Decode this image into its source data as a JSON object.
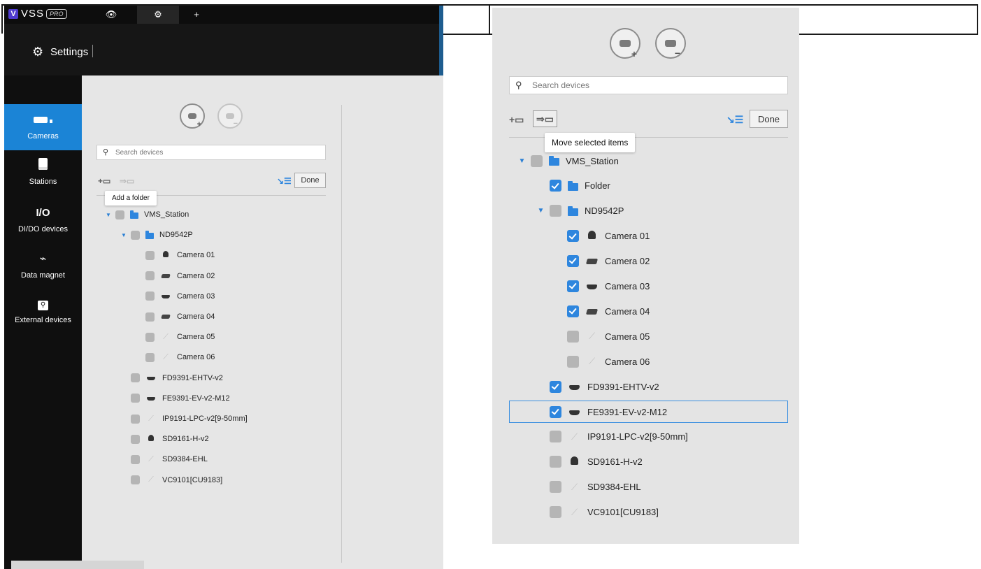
{
  "left_panel": {
    "app": {
      "logo_letter": "V",
      "name": "VSS",
      "badge": "PRO"
    },
    "top_tabs": [
      {
        "icon": "eye-icon",
        "glyph": "👁"
      },
      {
        "icon": "gear-icon",
        "glyph": "⚙"
      },
      {
        "icon": "plus-icon",
        "glyph": "+"
      }
    ],
    "header": {
      "title": "Settings"
    },
    "nav": [
      {
        "label": "Cameras",
        "icon": "camera-icon",
        "active": true
      },
      {
        "label": "Stations",
        "icon": "station-icon",
        "active": false
      },
      {
        "label": "DI/DO devices",
        "icon": "io-icon",
        "glyph": "I/O",
        "active": false
      },
      {
        "label": "Data magnet",
        "icon": "data-magnet-icon",
        "active": false
      },
      {
        "label": "External devices",
        "icon": "external-device-icon",
        "active": false
      }
    ],
    "search": {
      "placeholder": "Search devices"
    },
    "toolbar": {
      "done_label": "Done",
      "tooltip": "Add a folder"
    },
    "tree": [
      {
        "label": "VMS_Station",
        "type": "folder",
        "expanded": true
      },
      {
        "label": "ND9542P",
        "type": "folder",
        "expanded": true
      },
      {
        "label": "Camera 01",
        "type": "dome"
      },
      {
        "label": "Camera 02",
        "type": "bullet"
      },
      {
        "label": "Camera 03",
        "type": "flat"
      },
      {
        "label": "Camera 04",
        "type": "bullet"
      },
      {
        "label": "Camera 05",
        "type": "offline"
      },
      {
        "label": "Camera 06",
        "type": "offline"
      },
      {
        "label": "FD9391-EHTV-v2",
        "type": "flat"
      },
      {
        "label": "FE9391-EV-v2-M12",
        "type": "fisheye"
      },
      {
        "label": "IP9191-LPC-v2[9-50mm]",
        "type": "offline"
      },
      {
        "label": "SD9161-H-v2",
        "type": "dome"
      },
      {
        "label": "SD9384-EHL",
        "type": "offline"
      },
      {
        "label": "VC9101[CU9183]",
        "type": "offline"
      }
    ]
  },
  "right_panel": {
    "search": {
      "placeholder": "Search devices"
    },
    "toolbar": {
      "done_label": "Done",
      "tooltip": "Move selected items"
    },
    "tree": [
      {
        "label": "VMS_Station",
        "type": "folder",
        "expanded": true,
        "checked": false
      },
      {
        "label": "Folder",
        "type": "folder",
        "checked": true
      },
      {
        "label": "ND9542P",
        "type": "folder",
        "expanded": true,
        "checked": false
      },
      {
        "label": "Camera 01",
        "type": "dome",
        "checked": true
      },
      {
        "label": "Camera 02",
        "type": "bullet",
        "checked": true
      },
      {
        "label": "Camera 03",
        "type": "flat",
        "checked": true
      },
      {
        "label": "Camera 04",
        "type": "bullet",
        "checked": true
      },
      {
        "label": "Camera 05",
        "type": "offline",
        "checked": false
      },
      {
        "label": "Camera 06",
        "type": "offline",
        "checked": false
      },
      {
        "label": "FD9391-EHTV-v2",
        "type": "flat",
        "checked": true
      },
      {
        "label": "FE9391-EV-v2-M12",
        "type": "fisheye",
        "checked": true,
        "focused": true
      },
      {
        "label": "IP9191-LPC-v2[9-50mm]",
        "type": "offline",
        "checked": false
      },
      {
        "label": "SD9161-H-v2",
        "type": "dome",
        "checked": false
      },
      {
        "label": "SD9384-EHL",
        "type": "offline",
        "checked": false
      },
      {
        "label": "VC9101[CU9183]",
        "type": "offline",
        "checked": false
      }
    ]
  },
  "colors": {
    "accent": "#2e86de",
    "nav_active": "#1b84d6",
    "sidebar_bg": "#0f0f0f",
    "panel_bg": "#e6e6e6"
  }
}
